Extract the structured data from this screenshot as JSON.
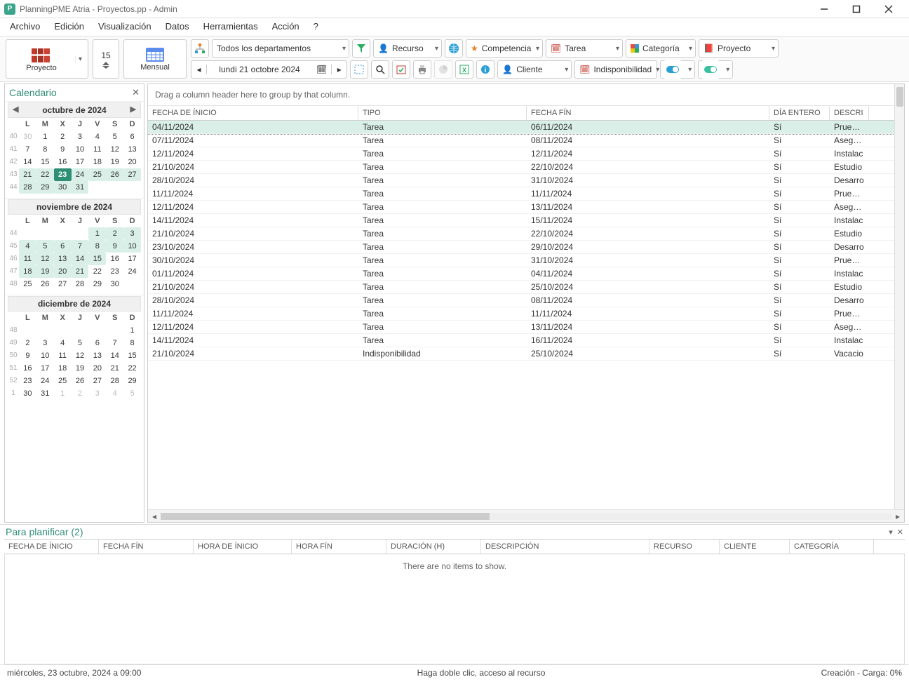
{
  "window": {
    "title": "PlanningPME Atria - Proyectos.pp - Admin",
    "app_glyph": "P"
  },
  "menu": [
    "Archivo",
    "Edición",
    "Visualización",
    "Datos",
    "Herramientas",
    "Acción",
    "?"
  ],
  "toolbar": {
    "proyecto": "Proyecto",
    "mensual": "Mensual",
    "spinner": "15",
    "depto_filter": "Todos los departamentos",
    "recurso": "Recurso",
    "competencia": "Competencia",
    "tarea": "Tarea",
    "categoria": "Categoría",
    "proyecto_combo": "Proyecto",
    "cliente": "Cliente",
    "indisponibilidad": "Indisponibilidad",
    "date": "lundi     21   octobre    2024"
  },
  "calendar_panel": {
    "title": "Calendario",
    "dow": [
      "L",
      "M",
      "X",
      "J",
      "V",
      "S",
      "D"
    ],
    "months": [
      {
        "title": "octubre de 2024",
        "show_nav": true,
        "weeks": [
          {
            "wk": "40",
            "days": [
              {
                "n": "30",
                "dim": true
              },
              {
                "n": "1"
              },
              {
                "n": "2"
              },
              {
                "n": "3"
              },
              {
                "n": "4"
              },
              {
                "n": "5"
              },
              {
                "n": "6"
              }
            ]
          },
          {
            "wk": "41",
            "days": [
              {
                "n": "7"
              },
              {
                "n": "8"
              },
              {
                "n": "9"
              },
              {
                "n": "10"
              },
              {
                "n": "11"
              },
              {
                "n": "12"
              },
              {
                "n": "13"
              }
            ]
          },
          {
            "wk": "42",
            "days": [
              {
                "n": "14"
              },
              {
                "n": "15"
              },
              {
                "n": "16"
              },
              {
                "n": "17"
              },
              {
                "n": "18"
              },
              {
                "n": "19"
              },
              {
                "n": "20"
              }
            ]
          },
          {
            "wk": "43",
            "days": [
              {
                "n": "21",
                "hl": true
              },
              {
                "n": "22",
                "hl": true
              },
              {
                "n": "23",
                "sel": true
              },
              {
                "n": "24",
                "hl": true
              },
              {
                "n": "25",
                "hl": true
              },
              {
                "n": "26",
                "hl": true
              },
              {
                "n": "27",
                "hl": true
              }
            ]
          },
          {
            "wk": "44",
            "days": [
              {
                "n": "28",
                "hl": true
              },
              {
                "n": "29",
                "hl": true
              },
              {
                "n": "30",
                "hl": true
              },
              {
                "n": "31",
                "hl": true
              },
              {
                "n": ""
              },
              {
                "n": ""
              },
              {
                "n": ""
              }
            ]
          }
        ]
      },
      {
        "title": "noviembre de 2024",
        "show_nav": false,
        "weeks": [
          {
            "wk": "44",
            "days": [
              {
                "n": ""
              },
              {
                "n": ""
              },
              {
                "n": ""
              },
              {
                "n": ""
              },
              {
                "n": "1",
                "hl": true
              },
              {
                "n": "2",
                "hl": true
              },
              {
                "n": "3",
                "hl": true
              }
            ]
          },
          {
            "wk": "45",
            "days": [
              {
                "n": "4",
                "hl": true
              },
              {
                "n": "5",
                "hl": true
              },
              {
                "n": "6",
                "hl": true
              },
              {
                "n": "7",
                "hl": true
              },
              {
                "n": "8",
                "hl": true
              },
              {
                "n": "9",
                "hl": true
              },
              {
                "n": "10",
                "hl": true
              }
            ]
          },
          {
            "wk": "46",
            "days": [
              {
                "n": "11",
                "hl": true
              },
              {
                "n": "12",
                "hl": true
              },
              {
                "n": "13",
                "hl": true
              },
              {
                "n": "14",
                "hl": true
              },
              {
                "n": "15",
                "hl": true
              },
              {
                "n": "16"
              },
              {
                "n": "17"
              }
            ]
          },
          {
            "wk": "47",
            "days": [
              {
                "n": "18",
                "hl": true
              },
              {
                "n": "19",
                "hl": true
              },
              {
                "n": "20",
                "hl": true
              },
              {
                "n": "21",
                "hl": true
              },
              {
                "n": "22"
              },
              {
                "n": "23"
              },
              {
                "n": "24"
              }
            ]
          },
          {
            "wk": "48",
            "days": [
              {
                "n": "25"
              },
              {
                "n": "26"
              },
              {
                "n": "27"
              },
              {
                "n": "28"
              },
              {
                "n": "29"
              },
              {
                "n": "30"
              },
              {
                "n": ""
              }
            ]
          }
        ]
      },
      {
        "title": "diciembre de 2024",
        "show_nav": false,
        "weeks": [
          {
            "wk": "48",
            "days": [
              {
                "n": ""
              },
              {
                "n": ""
              },
              {
                "n": ""
              },
              {
                "n": ""
              },
              {
                "n": ""
              },
              {
                "n": ""
              },
              {
                "n": "1"
              }
            ]
          },
          {
            "wk": "49",
            "days": [
              {
                "n": "2"
              },
              {
                "n": "3"
              },
              {
                "n": "4"
              },
              {
                "n": "5"
              },
              {
                "n": "6"
              },
              {
                "n": "7"
              },
              {
                "n": "8"
              }
            ]
          },
          {
            "wk": "50",
            "days": [
              {
                "n": "9"
              },
              {
                "n": "10"
              },
              {
                "n": "11"
              },
              {
                "n": "12"
              },
              {
                "n": "13"
              },
              {
                "n": "14"
              },
              {
                "n": "15"
              }
            ]
          },
          {
            "wk": "51",
            "days": [
              {
                "n": "16"
              },
              {
                "n": "17"
              },
              {
                "n": "18"
              },
              {
                "n": "19"
              },
              {
                "n": "20"
              },
              {
                "n": "21"
              },
              {
                "n": "22"
              }
            ]
          },
          {
            "wk": "52",
            "days": [
              {
                "n": "23"
              },
              {
                "n": "24"
              },
              {
                "n": "25"
              },
              {
                "n": "26"
              },
              {
                "n": "27"
              },
              {
                "n": "28"
              },
              {
                "n": "29"
              }
            ]
          },
          {
            "wk": "1",
            "days": [
              {
                "n": "30"
              },
              {
                "n": "31"
              },
              {
                "n": "1",
                "dim": true
              },
              {
                "n": "2",
                "dim": true
              },
              {
                "n": "3",
                "dim": true
              },
              {
                "n": "4",
                "dim": true
              },
              {
                "n": "5",
                "dim": true
              }
            ]
          }
        ]
      }
    ]
  },
  "grid": {
    "group_hint": "Drag a column header here to group by that column.",
    "columns": [
      "FECHA DE ÍNICIO",
      "TIPO",
      "FECHA FÍN",
      "DÍA ENTERO",
      "DESCRI"
    ],
    "rows": [
      {
        "start": "04/11/2024",
        "type": "Tarea",
        "end": "06/11/2024",
        "all": "Sí",
        "desc": "Pruebas",
        "sel": true
      },
      {
        "start": "07/11/2024",
        "type": "Tarea",
        "end": "08/11/2024",
        "all": "Sí",
        "desc": "Asegura"
      },
      {
        "start": "12/11/2024",
        "type": "Tarea",
        "end": "12/11/2024",
        "all": "Sí",
        "desc": "Instalac"
      },
      {
        "start": "21/10/2024",
        "type": "Tarea",
        "end": "22/10/2024",
        "all": "Sí",
        "desc": "Estudio"
      },
      {
        "start": "28/10/2024",
        "type": "Tarea",
        "end": "31/10/2024",
        "all": "Sí",
        "desc": "Desarro"
      },
      {
        "start": "11/11/2024",
        "type": "Tarea",
        "end": "11/11/2024",
        "all": "Sí",
        "desc": "Pruebas"
      },
      {
        "start": "12/11/2024",
        "type": "Tarea",
        "end": "13/11/2024",
        "all": "Sí",
        "desc": "Asegura"
      },
      {
        "start": "14/11/2024",
        "type": "Tarea",
        "end": "15/11/2024",
        "all": "Sí",
        "desc": "Instalac"
      },
      {
        "start": "21/10/2024",
        "type": "Tarea",
        "end": "22/10/2024",
        "all": "Sí",
        "desc": "Estudio"
      },
      {
        "start": "23/10/2024",
        "type": "Tarea",
        "end": "29/10/2024",
        "all": "Sí",
        "desc": "Desarro"
      },
      {
        "start": "30/10/2024",
        "type": "Tarea",
        "end": "31/10/2024",
        "all": "Sí",
        "desc": "Pruebas"
      },
      {
        "start": "01/11/2024",
        "type": "Tarea",
        "end": "04/11/2024",
        "all": "Sí",
        "desc": "Instalac"
      },
      {
        "start": "21/10/2024",
        "type": "Tarea",
        "end": "25/10/2024",
        "all": "Sí",
        "desc": "Estudio"
      },
      {
        "start": "28/10/2024",
        "type": "Tarea",
        "end": "08/11/2024",
        "all": "Sí",
        "desc": "Desarro"
      },
      {
        "start": "11/11/2024",
        "type": "Tarea",
        "end": "11/11/2024",
        "all": "Sí",
        "desc": "Pruebas"
      },
      {
        "start": "12/11/2024",
        "type": "Tarea",
        "end": "13/11/2024",
        "all": "Sí",
        "desc": "Asegura"
      },
      {
        "start": "14/11/2024",
        "type": "Tarea",
        "end": "16/11/2024",
        "all": "Sí",
        "desc": "Instalac"
      },
      {
        "start": "21/10/2024",
        "type": "Indisponibilidad",
        "end": "25/10/2024",
        "all": "Sí",
        "desc": "Vacacio"
      }
    ]
  },
  "planner": {
    "title": "Para planificar (2)",
    "columns": [
      "FECHA DE ÍNICIO",
      "FECHA FÍN",
      "HORA DE ÍNICIO",
      "HORA FÍN",
      "DURACIÓN (H)",
      "DESCRIPCIÓN",
      "RECURSO",
      "CLIENTE",
      "CATEGORÍA"
    ],
    "empty": "There are no items to show."
  },
  "status": {
    "left": "miércoles, 23 octubre, 2024 a 09:00",
    "center": "Haga doble clic, acceso al recurso",
    "right": "Creación - Carga: 0%"
  }
}
